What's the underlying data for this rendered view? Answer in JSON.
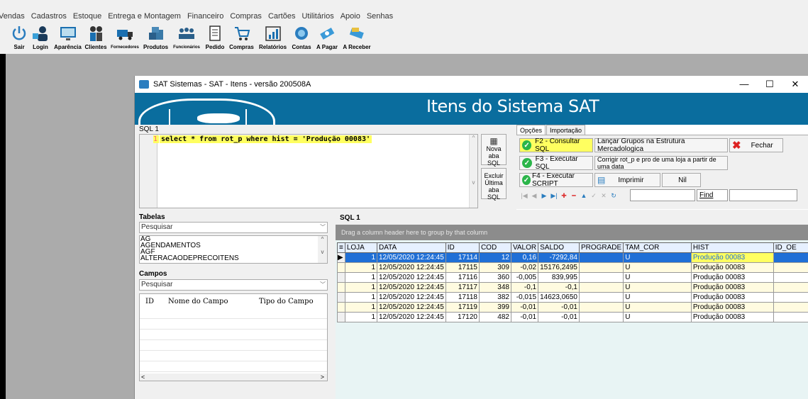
{
  "menubar": [
    "Vendas",
    "Cadastros",
    "Estoque",
    "Entrega e Montagem",
    "Financeiro",
    "Compras",
    "Cartões",
    "Utilitários",
    "Apoio",
    "Senhas"
  ],
  "toolbar": [
    {
      "label": "Sair",
      "icon": "power-icon"
    },
    {
      "label": "Login",
      "icon": "login-icon"
    },
    {
      "label": "Aparência",
      "icon": "monitor-icon"
    },
    {
      "label": "Clientes",
      "icon": "users-icon"
    },
    {
      "label": "Fornecedores",
      "icon": "truck-icon"
    },
    {
      "label": "Produtos",
      "icon": "boxes-icon"
    },
    {
      "label": "Funcionários",
      "icon": "team-icon"
    },
    {
      "label": "Pedido",
      "icon": "document-icon"
    },
    {
      "label": "Compras",
      "icon": "cart-icon"
    },
    {
      "label": "Relatórios",
      "icon": "chart-icon"
    },
    {
      "label": "Contas",
      "icon": "contas-icon"
    },
    {
      "label": "A Pagar",
      "icon": "pay-icon"
    },
    {
      "label": "A Receber",
      "icon": "receive-icon"
    }
  ],
  "window": {
    "title": "SAT Sistemas - SAT - Itens - versão 200508A",
    "banner": "Itens do Sistema SAT",
    "minimize": "—",
    "maximize": "☐",
    "close": "✕"
  },
  "sql_tab": "SQL 1",
  "editor": {
    "line_number": "1",
    "line_text": "select * from rot_p where hist = 'Produção 00083'"
  },
  "side_buttons": {
    "new_tab": "Nova aba SQL",
    "delete_tab_l1": "Excluir",
    "delete_tab_l2": "Última aba",
    "delete_tab_l3": "SQL"
  },
  "options": {
    "tabs": [
      "Opções",
      "Importação"
    ],
    "f2": "F2 - Consultar SQL",
    "f3": "F3 - Executar SQL",
    "f4": "F4 - Executar SCRIPT",
    "lancar": "Lançar Grupos na Estrutura Mercadologica",
    "corrigir": "Corrigir rot_p e pro de uma loja a partir de uma data",
    "imprimir": "Imprimir",
    "nil": "Nil",
    "fechar": "Fechar",
    "find": "Find"
  },
  "tabelas": {
    "title": "Tabelas",
    "search_placeholder": "Pesquisar",
    "items": [
      "AG",
      "AGENDAMENTOS",
      "AGF",
      "ALTERACAODEPRECOITENS"
    ]
  },
  "campos": {
    "title": "Campos",
    "search_placeholder": "Pesquisar",
    "headers": [
      "ID",
      "Nome do Campo",
      "Tipo do Campo"
    ]
  },
  "grid": {
    "title": "SQL 1",
    "group_hint": "Drag a column header here to group by that column",
    "columns": [
      "LOJA",
      "DATA",
      "ID",
      "COD",
      "VALOR",
      "SALDO",
      "PROGRADE",
      "TAM_COR",
      "HIST",
      "ID_OE"
    ],
    "rows": [
      [
        "1",
        "12/05/2020 12:24:45",
        "17114",
        "12",
        "0,16",
        "-7292,84",
        "",
        "U",
        "Produção 00083",
        ""
      ],
      [
        "1",
        "12/05/2020 12:24:45",
        "17115",
        "309",
        "-0,02",
        "15176,2495",
        "",
        "U",
        "Produção 00083",
        ""
      ],
      [
        "1",
        "12/05/2020 12:24:45",
        "17116",
        "360",
        "-0,005",
        "839,995",
        "",
        "U",
        "Produção 00083",
        ""
      ],
      [
        "1",
        "12/05/2020 12:24:45",
        "17117",
        "348",
        "-0,1",
        "-0,1",
        "",
        "U",
        "Produção 00083",
        ""
      ],
      [
        "1",
        "12/05/2020 12:24:45",
        "17118",
        "382",
        "-0,015",
        "14623,0650",
        "",
        "U",
        "Produção 00083",
        ""
      ],
      [
        "1",
        "12/05/2020 12:24:45",
        "17119",
        "399",
        "-0,01",
        "-0,01",
        "",
        "U",
        "Produção 00083",
        ""
      ],
      [
        "1",
        "12/05/2020 12:24:45",
        "17120",
        "482",
        "-0,01",
        "-0,01",
        "",
        "U",
        "Produção 00083",
        ""
      ]
    ]
  }
}
